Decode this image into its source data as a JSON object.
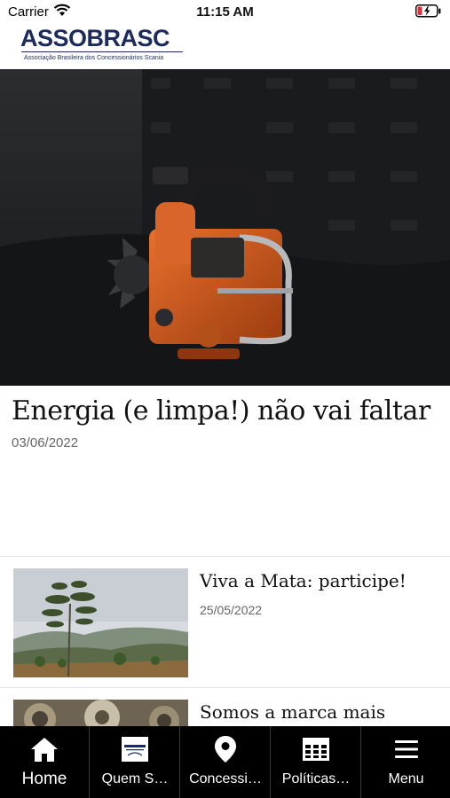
{
  "status_bar": {
    "carrier": "Carrier",
    "time": "11:15 AM"
  },
  "header": {
    "logo_text": "ASSOBRASC",
    "logo_tagline": "Associação Brasileira dos Concessionários Scania"
  },
  "featured": {
    "title": "Energia (e limpa!) não vai faltar",
    "date": "03/06/2022",
    "image": "orange-scania-engine-photo"
  },
  "news": [
    {
      "title": "Viva a Mata: participe!",
      "date": "25/05/2022",
      "image": "young-tree-landscape-photo"
    },
    {
      "title": "Somos a marca mais",
      "date": "",
      "image": "engine-parts-photo"
    }
  ],
  "tab_bar": {
    "tabs": [
      {
        "label": "Home",
        "icon": "home-icon"
      },
      {
        "label": "Quem S…",
        "icon": "logo-card-icon"
      },
      {
        "label": "Concessi…",
        "icon": "map-pin-icon"
      },
      {
        "label": "Políticas…",
        "icon": "table-icon"
      },
      {
        "label": "Menu",
        "icon": "menu-icon"
      }
    ]
  }
}
